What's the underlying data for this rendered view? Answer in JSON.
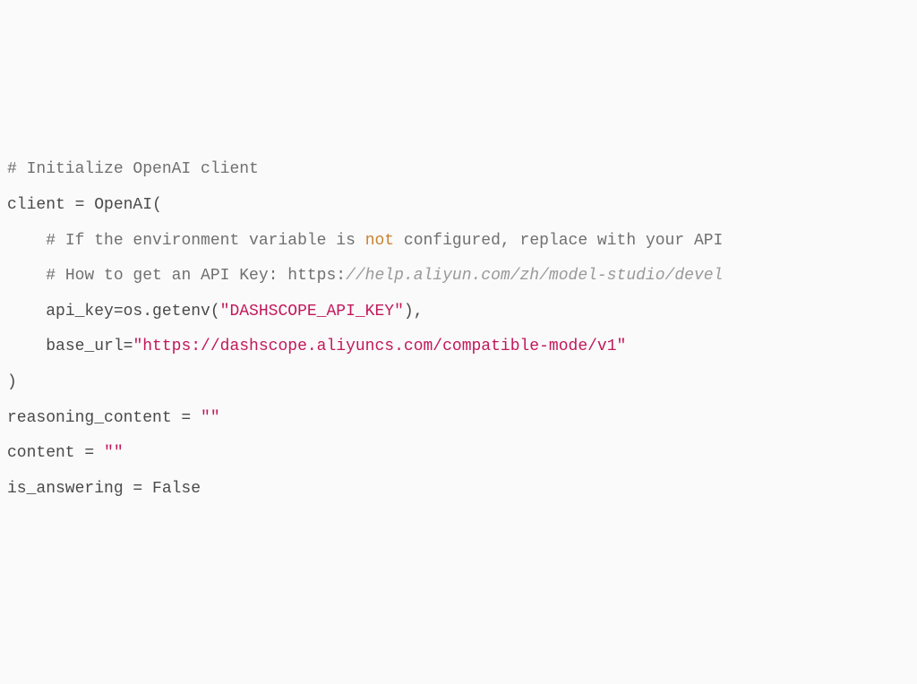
{
  "code": {
    "line1": {
      "comment": "# Initialize OpenAI client"
    },
    "line2": {
      "text": "client = OpenAI("
    },
    "line3": {
      "indent": "    ",
      "comment_prefix": "# If the environment variable is ",
      "keyword": "not",
      "comment_suffix": " configured, replace with your API "
    },
    "line4": {
      "indent": "    ",
      "comment_prefix": "# How to get an API Key: https:",
      "url_part": "//help.aliyun.com/zh/model-studio/devel"
    },
    "line5": {
      "indent": "    ",
      "text_prefix": "api_key=os.getenv(",
      "string": "\"DASHSCOPE_API_KEY\"",
      "text_suffix": "),"
    },
    "line6": {
      "indent": "    ",
      "text_prefix": "base_url=",
      "string": "\"https://dashscope.aliyuncs.com/compatible-mode/v1\""
    },
    "line7": {
      "text": ")"
    },
    "line8": {
      "text": ""
    },
    "line9": {
      "text_prefix": "reasoning_content = ",
      "string": "\"\""
    },
    "line10": {
      "text_prefix": "content = ",
      "string": "\"\""
    },
    "line11": {
      "text": ""
    },
    "line12": {
      "text": "is_answering = False"
    }
  }
}
